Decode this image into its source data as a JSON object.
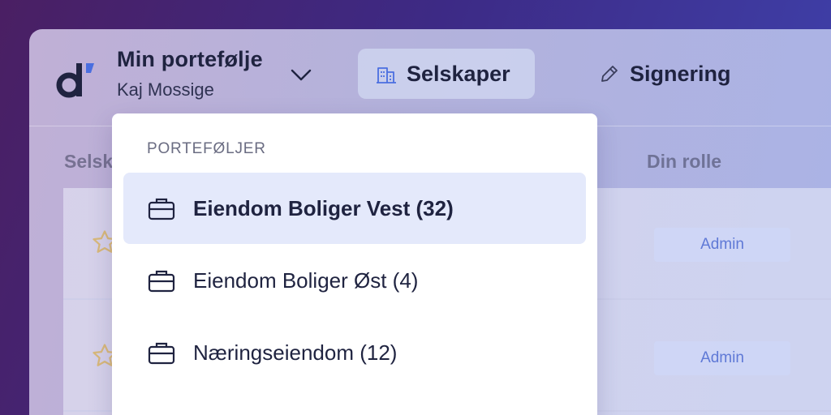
{
  "header": {
    "portfolio_name": "Min portefølje",
    "user_name": "Kaj Mossige",
    "tabs": [
      {
        "label": "Selskaper",
        "icon": "building-icon",
        "active": true
      },
      {
        "label": "Signering",
        "icon": "pencil-icon",
        "active": false
      }
    ]
  },
  "table": {
    "columns": [
      "Selsk",
      "Din rolle"
    ],
    "rows": [
      {
        "role": "Admin"
      },
      {
        "role": "Admin"
      }
    ]
  },
  "dropdown": {
    "heading": "PORTEFØLJER",
    "items": [
      {
        "label": "Eiendom Boliger Vest (32)",
        "icon": "briefcase-icon",
        "selected": true
      },
      {
        "label": "Eiendom Boliger Øst (4)",
        "icon": "briefcase-icon",
        "selected": false
      },
      {
        "label": "Næringseiendom (12)",
        "icon": "briefcase-icon",
        "selected": false
      }
    ]
  },
  "colors": {
    "brand_dark": "#1f2340",
    "brand_blue": "#4a6ee0",
    "selected_bg": "#e4e9fb",
    "badge_text": "#5f79d6"
  }
}
